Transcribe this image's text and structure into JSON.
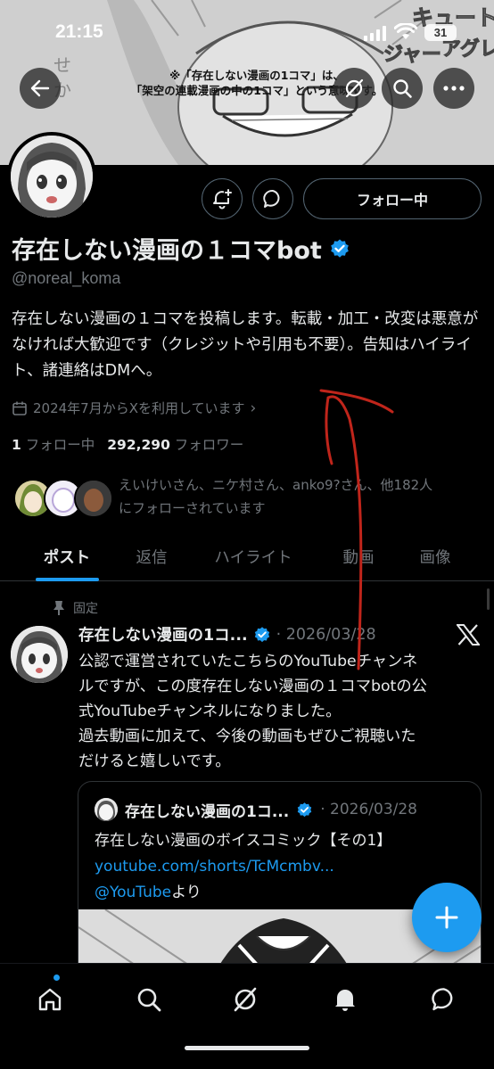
{
  "status_bar": {
    "time": "21:15",
    "battery": "31"
  },
  "banner": {
    "caption_line1": "※「存在しない漫画の1コマ」は、",
    "caption_line2": "「架空の連載漫画の中の1コマ」という意味です。"
  },
  "profile": {
    "display_name": "存在しない漫画の１コマbot",
    "handle": "@noreal_koma",
    "bio": "存在しない漫画の１コマを投稿します。転載・加工・改変は悪意がなければ大歓迎です（クレジットや引用も不要）。告知はハイライト、諸連絡はDMへ。",
    "joined": "2024年7月からXを利用しています",
    "following_count": "1",
    "following_label": "フォロー中",
    "followers_count": "292,290",
    "followers_label": "フォロワー",
    "follow_button": "フォロー中",
    "followed_by_line1": "えいけいさん、ニケ村さん、anko9?さん、他182人",
    "followed_by_line2": "にフォローされています"
  },
  "tabs": [
    "ポスト",
    "返信",
    "ハイライト",
    "動画",
    "画像"
  ],
  "post": {
    "pinned_label": "固定",
    "author": "存在しない漫画の1コ...",
    "date": "· 2026/03/28",
    "body_lines": [
      "公認で運営されていたこちらのYouTubeチャンネ",
      "ルですが、この度存在しない漫画の１コマbotの公",
      "式YouTubeチャンネルになりました。",
      "過去動画に加えて、今後の動画もぜひご視聴いた",
      "だけると嬉しいです。"
    ],
    "quote": {
      "author": "存在しない漫画の1コ...",
      "date": "· 2026/03/28",
      "text": "存在しない漫画のボイスコミック【その1】",
      "link": "youtube.com/shorts/TcMcmbv...",
      "mention": "@YouTube",
      "mention_suffix": "より"
    }
  },
  "colors": {
    "accent": "#1d9bf0",
    "background": "#000000",
    "muted": "#71767b",
    "annotation": "#c0251b"
  },
  "icons": [
    "back-arrow-icon",
    "grok-icon",
    "search-icon",
    "more-icon",
    "notify-add-icon",
    "message-icon",
    "verified-badge-icon",
    "calendar-icon",
    "pin-icon",
    "x-logo-icon",
    "compose-plus-icon",
    "home-icon",
    "search-icon",
    "grok-icon",
    "bell-icon",
    "messages-icon"
  ]
}
